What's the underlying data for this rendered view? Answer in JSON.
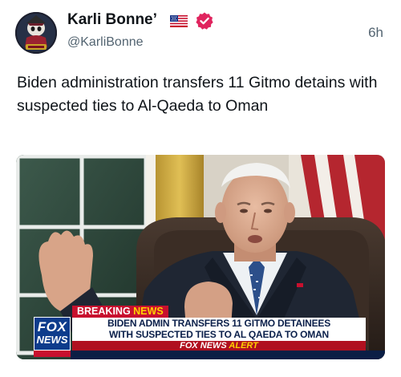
{
  "author": {
    "display_name": "Karli Bonne’",
    "handle": "@KarliBonne",
    "flag_icon": "us-flag-emoji",
    "verified_icon": "verified-badge-icon",
    "verified_color": "#e0245e"
  },
  "timestamp": "6h",
  "post": {
    "text": "Biden administration transfers 11 Gitmo detains with suspected ties to Al-Qaeda to Oman"
  },
  "media": {
    "channel_logo_line1": "FOX",
    "channel_logo_line2": "NEWS",
    "breaking_label_1": "BREAKING",
    "breaking_label_2": "NEWS",
    "headline_line1": "BIDEN ADMIN TRANSFERS 11 GITMO DETAINEES",
    "headline_line2": "WITH SUSPECTED TIES TO AL QAEDA TO OMAN",
    "alert_part1": "FOX NEWS",
    "alert_part2": "ALERT",
    "brand_colors": {
      "fox_red": "#c8102e",
      "fox_blue": "#0d3c8c",
      "alert_yellow": "#ffd200"
    }
  }
}
